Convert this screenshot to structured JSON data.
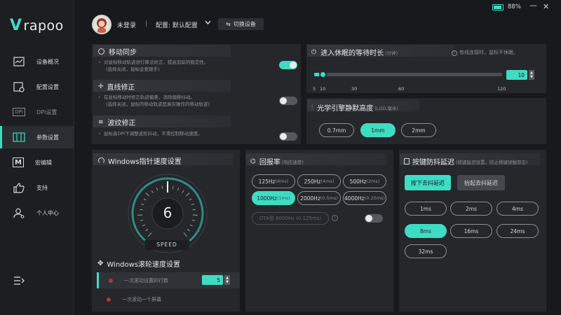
{
  "brand": {
    "logo_text": "rapoo"
  },
  "status": {
    "battery_text": "88%",
    "battery_level": 0.88
  },
  "window": {
    "minimize": "—",
    "close": "✕"
  },
  "header": {
    "user": "未登录",
    "separator": "|",
    "config": "配置: 默认配置",
    "switch_device": "切换设备"
  },
  "sidebar": {
    "items": [
      {
        "label": "设备概况",
        "icon": "chart-line-icon",
        "active": false
      },
      {
        "label": "配置设置",
        "icon": "settings-gear-icon",
        "active": false
      },
      {
        "label": "DPI设置",
        "icon": "dpi-icon",
        "active": false,
        "icon_text": "DPI"
      },
      {
        "label": "参数设置",
        "icon": "sliders-icon",
        "active": true
      },
      {
        "label": "宏编辑",
        "icon": "macro-icon",
        "active": false,
        "icon_text": "M"
      },
      {
        "label": "支持",
        "icon": "thumbs-up-icon",
        "active": false
      },
      {
        "label": "个人中心",
        "icon": "user-icon",
        "active": false
      }
    ],
    "collapse_icon": "menu-collapse-icon"
  },
  "motion_sync": {
    "title": "移动同步",
    "note_line1": "对鼠标移动轨迹进行算法修正，提高追踪的稳定性。",
    "note_line2": "(选择关闭，鼠标会更跟手)",
    "enabled": true
  },
  "angle_snap": {
    "title": "直线修正",
    "note_line1": "在鼠标移动时修正轨迹偏差，消除偏移抖动。",
    "note_line2": "(选择关闭，鼠标的移动轨迹是真实操作的移动轨迹)",
    "enabled": false
  },
  "ripple": {
    "title": "波纹修正",
    "note_line1": "鼠标高DPI下调整波形抖动，平滑控制移动速度。",
    "enabled": false
  },
  "sleep": {
    "title": "进入休眠的等待时长",
    "unit": "(分钟)",
    "hint": "有线连接时，鼠标不休眠。",
    "value": "10",
    "min": 5,
    "max": 120,
    "ticks": [
      "5",
      "10",
      "30",
      "60",
      "120"
    ],
    "slider_fraction": 0.043
  },
  "lod": {
    "title": "光学引擎静默高度",
    "unit": "(LOD,毫米)",
    "options": [
      "0.7mm",
      "1mm",
      "2mm"
    ],
    "selected": "1mm"
  },
  "windows_speed": {
    "title": "Windows指针速度设置",
    "value": "6",
    "label": "SPEED",
    "min": 1,
    "max": 11
  },
  "windows_scroll": {
    "title": "Windows滚轮速度设置",
    "row1": "一次滚动设置的行数",
    "row1_value": "5",
    "row2": "一次滚动一个屏幕"
  },
  "polling": {
    "title": "回报率",
    "unit": "(响应速度)",
    "options": [
      {
        "main": "125Hz",
        "sub": "(8ms)"
      },
      {
        "main": "250Hz",
        "sub": "(4ms)"
      },
      {
        "main": "500Hz",
        "sub": "(2ms)"
      },
      {
        "main": "1000Hz",
        "sub": "(1ms)"
      },
      {
        "main": "2000Hz",
        "sub": "(0.5ms)"
      },
      {
        "main": "4000Hz",
        "sub": "(0.25ms)"
      }
    ],
    "selected": "1000Hz",
    "ota": "OTA型 8000Hz (0.125ms)",
    "ota_enabled": false
  },
  "debounce": {
    "title": "按键防抖延迟",
    "hint": "(按键延迟设置，防止按键误触双击)",
    "tab_press": "按下去抖延迟",
    "tab_release": "抬起去抖延迟",
    "options": [
      "1ms",
      "2ms",
      "4ms",
      "8ms",
      "16ms",
      "24ms",
      "32ms"
    ],
    "selected": "8ms"
  },
  "colors": {
    "accent": "#3fdcc4",
    "bg": "#17191c",
    "panel": "#25272b",
    "alert": "#d84b4b"
  }
}
